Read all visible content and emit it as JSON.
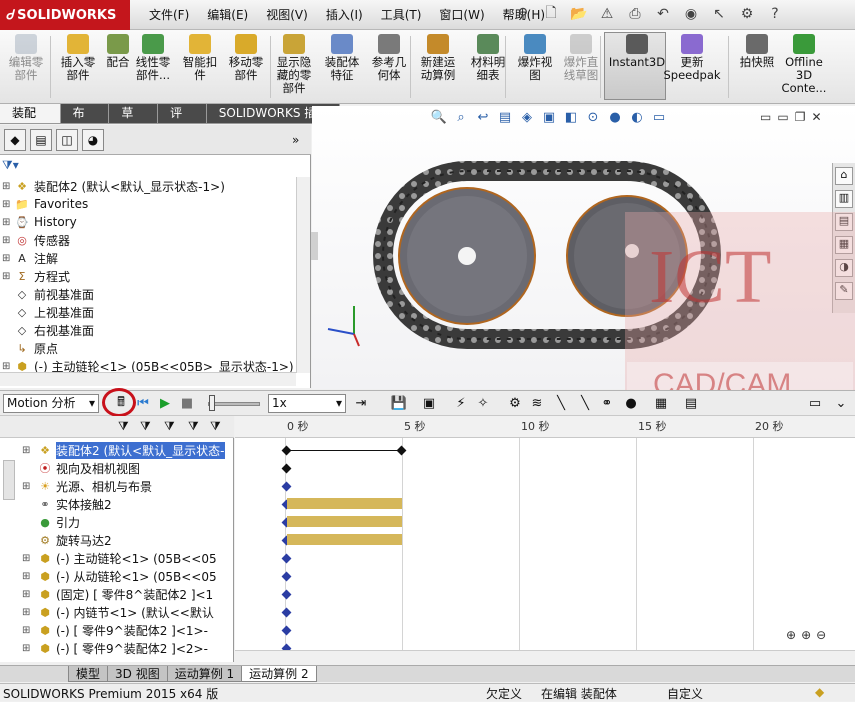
{
  "app": {
    "logo": "SOLIDWORKS"
  },
  "menu": [
    "文件(F)",
    "编辑(E)",
    "视图(V)",
    "插入(I)",
    "工具(T)",
    "窗口(W)",
    "帮助(H)"
  ],
  "commands": [
    {
      "label": "编辑零\n部件",
      "icon": "edit-part-icon",
      "disabled": true
    },
    {
      "label": "插入零\n部件",
      "icon": "insert-component-icon",
      "disabled": false
    },
    {
      "label": "配合",
      "icon": "mate-icon",
      "disabled": false
    },
    {
      "label": "线性零\n部件...",
      "icon": "linear-pattern-icon",
      "disabled": false
    },
    {
      "label": "智能扣\n件",
      "icon": "smart-fasteners-icon",
      "disabled": false
    },
    {
      "label": "移动零\n部件",
      "icon": "move-component-icon",
      "disabled": false
    },
    {
      "label": "显示隐\n藏的零\n部件",
      "icon": "show-hidden-icon",
      "disabled": false
    },
    {
      "label": "装配体\n特征",
      "icon": "assembly-features-icon",
      "disabled": false
    },
    {
      "label": "参考几\n何体",
      "icon": "reference-geometry-icon",
      "disabled": false
    },
    {
      "label": "新建运\n动算例",
      "icon": "new-motion-study-icon",
      "disabled": false
    },
    {
      "label": "材料明\n细表",
      "icon": "bom-icon",
      "disabled": false
    },
    {
      "label": "爆炸视\n图",
      "icon": "exploded-view-icon",
      "disabled": false
    },
    {
      "label": "爆炸直\n线草图",
      "icon": "explode-line-sketch-icon",
      "disabled": true
    },
    {
      "label": "Instant3D",
      "icon": "instant3d-icon",
      "disabled": false
    },
    {
      "label": "更新\nSpeedpak",
      "icon": "speedpak-icon",
      "disabled": false
    },
    {
      "label": "拍快照",
      "icon": "snapshot-icon",
      "disabled": false
    },
    {
      "label": "Offline\n3D\nConte...",
      "icon": "offline-3d-icon",
      "disabled": false
    }
  ],
  "command_tabs": [
    "装配体",
    "布局",
    "草图",
    "评估",
    "SOLIDWORKS 插件"
  ],
  "feature_tree": [
    {
      "label": "装配体2  (默认<默认_显示状态-1>)",
      "icon": "assembly-icon"
    },
    {
      "label": "Favorites",
      "icon": "folder-icon"
    },
    {
      "label": "History",
      "icon": "history-icon"
    },
    {
      "label": "传感器",
      "icon": "sensor-icon"
    },
    {
      "label": "注解",
      "icon": "annotation-icon"
    },
    {
      "label": "方程式",
      "icon": "equation-icon"
    },
    {
      "label": "前视基准面",
      "icon": "plane-icon"
    },
    {
      "label": "上视基准面",
      "icon": "plane-icon"
    },
    {
      "label": "右视基准面",
      "icon": "plane-icon"
    },
    {
      "label": "原点",
      "icon": "origin-icon"
    },
    {
      "label": "(-) 主动链轮<1> (05B<<05B>_显示状态-1>)",
      "icon": "part-icon"
    }
  ],
  "motion": {
    "study_type": "Motion 分析",
    "speed": "1x",
    "ticks": [
      "0 秒",
      "5 秒",
      "10 秒",
      "15 秒",
      "20 秒"
    ],
    "tree": [
      {
        "label": "装配体2  (默认<默认_显示状态-",
        "icon": "assembly-icon",
        "selected": true
      },
      {
        "label": "视向及相机视图",
        "icon": "camera-view-icon"
      },
      {
        "label": "光源、相机与布景",
        "icon": "lights-icon"
      },
      {
        "label": "实体接触2",
        "icon": "contact-icon"
      },
      {
        "label": "引力",
        "icon": "gravity-icon"
      },
      {
        "label": "旋转马达2",
        "icon": "motor-icon"
      },
      {
        "label": "(-) 主动链轮<1> (05B<<05",
        "icon": "part-icon"
      },
      {
        "label": "(-) 从动链轮<1> (05B<<05",
        "icon": "part-icon"
      },
      {
        "label": "(固定) [ 零件8^装配体2 ]<1",
        "icon": "part-icon"
      },
      {
        "label": "(-) 内链节<1> (默认<<默认",
        "icon": "part-icon"
      },
      {
        "label": "(-) [ 零件9^装配体2 ]<1>-",
        "icon": "part-icon"
      },
      {
        "label": "(-) [ 零件9^装配体2 ]<2>-",
        "icon": "part-icon"
      }
    ]
  },
  "bottom_tabs": [
    "模型",
    "3D 视图",
    "运动算例 1",
    "运动算例 2"
  ],
  "status": {
    "product": "SOLIDWORKS Premium 2015 x64 版",
    "defined": "欠定义",
    "editing": "在编辑 装配体",
    "custom": "自定义"
  },
  "watermark": {
    "line1": "ICT",
    "line2": "CAD/CAM"
  },
  "colors": {
    "brand_red": "#c4161c",
    "bar_gold": "#d5b75a",
    "key_blue": "#2b3da3"
  }
}
